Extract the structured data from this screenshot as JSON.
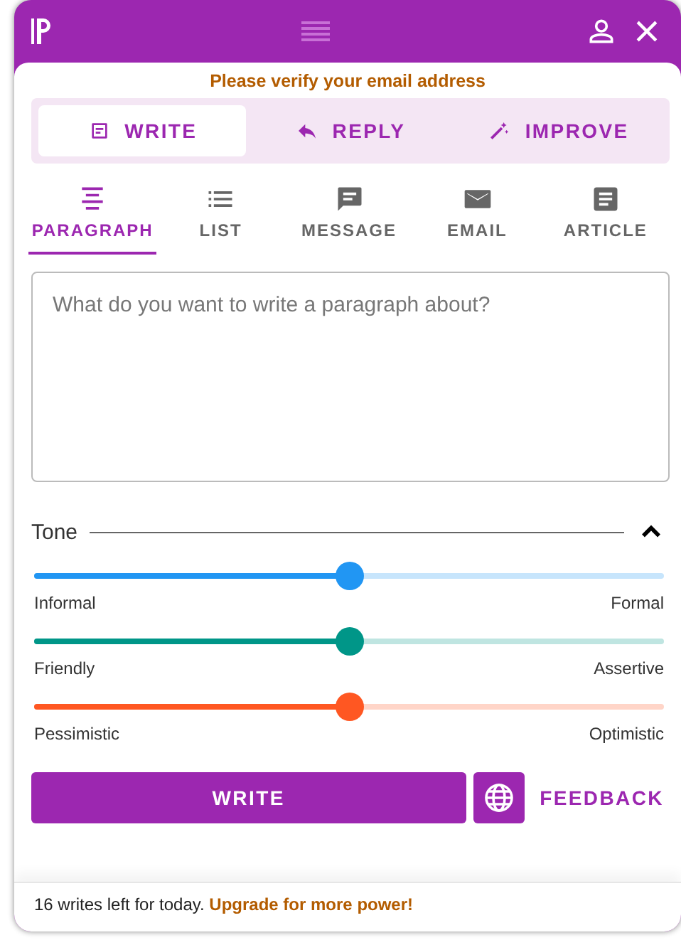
{
  "notice": "Please verify your email address",
  "modes": [
    {
      "label": "WRITE",
      "selected": true
    },
    {
      "label": "REPLY",
      "selected": false
    },
    {
      "label": "IMPROVE",
      "selected": false
    }
  ],
  "types": [
    {
      "label": "PARAGRAPH",
      "selected": true
    },
    {
      "label": "LIST",
      "selected": false
    },
    {
      "label": "MESSAGE",
      "selected": false
    },
    {
      "label": "EMAIL",
      "selected": false
    },
    {
      "label": "ARTICLE",
      "selected": false
    }
  ],
  "prompt": {
    "placeholder": "What do you want to write a paragraph about?"
  },
  "tone": {
    "title": "Tone",
    "expanded": true,
    "sliders": [
      {
        "left": "Informal",
        "right": "Formal",
        "level": 0.5,
        "color": "#2196f3"
      },
      {
        "left": "Friendly",
        "right": "Assertive",
        "level": 0.5,
        "color": "#009688"
      },
      {
        "left": "Pessimistic",
        "right": "Optimistic",
        "level": 0.5,
        "color": "#ff5722"
      }
    ]
  },
  "actions": {
    "write": "WRITE",
    "feedback": "FEEDBACK"
  },
  "footer": "16 writes left for today. **Upgrade for more power!**"
}
